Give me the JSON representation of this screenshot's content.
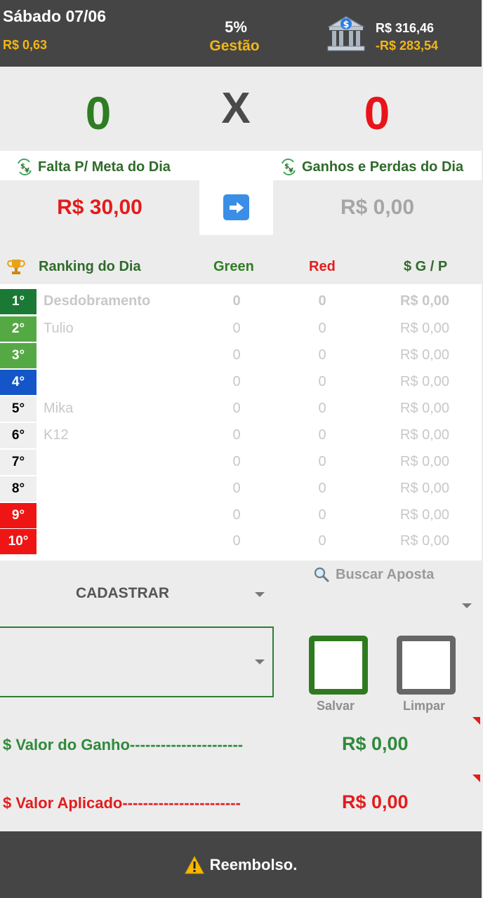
{
  "header": {
    "date": "Sábado 07/06",
    "left_value": "R$ 0,63",
    "percent": "5%",
    "gestao": "Gestão",
    "bank_icon": "bank-icon",
    "balance_primary": "R$ 316,46",
    "balance_secondary": "-R$ 283,54"
  },
  "score": {
    "green": "0",
    "separator": "X",
    "red": "0"
  },
  "meta": {
    "left_title": "Falta P/ Meta do Dia",
    "left_value": "R$ 30,00",
    "right_title": "Ganhos e Perdas do Dia",
    "right_value": "R$ 0,00",
    "arrow_icon": "arrow-right-icon"
  },
  "ranking": {
    "title": "Ranking do Dia",
    "col_green": "Green",
    "col_red": "Red",
    "col_gp": "$ G / P",
    "rows": [
      {
        "pos": "1°",
        "name": "Desdobramento",
        "green": "0",
        "red": "0",
        "gp": "R$ 0,00"
      },
      {
        "pos": "2°",
        "name": "Tulio",
        "green": "0",
        "red": "0",
        "gp": "R$ 0,00"
      },
      {
        "pos": "3°",
        "name": "",
        "green": "0",
        "red": "0",
        "gp": "R$ 0,00"
      },
      {
        "pos": "4°",
        "name": "",
        "green": "0",
        "red": "0",
        "gp": "R$ 0,00"
      },
      {
        "pos": "5°",
        "name": "Mika",
        "green": "0",
        "red": "0",
        "gp": "R$ 0,00"
      },
      {
        "pos": "6°",
        "name": "K12",
        "green": "0",
        "red": "0",
        "gp": "R$ 0,00"
      },
      {
        "pos": "7°",
        "name": "",
        "green": "0",
        "red": "0",
        "gp": "R$ 0,00"
      },
      {
        "pos": "8°",
        "name": "",
        "green": "0",
        "red": "0",
        "gp": "R$ 0,00"
      },
      {
        "pos": "9°",
        "name": "",
        "green": "0",
        "red": "0",
        "gp": "R$ 0,00"
      },
      {
        "pos": "10°",
        "name": "",
        "green": "0",
        "red": "0",
        "gp": "R$ 0,00"
      }
    ]
  },
  "form": {
    "cadastrar": "CADASTRAR",
    "search_label": "Buscar Aposta",
    "save_label": "Salvar",
    "clear_label": "Limpar",
    "gain_label": "$ Valor do Ganho----------------------",
    "gain_value": "R$ 0,00",
    "applied_label": "$ Valor Aplicado-----------------------",
    "applied_value": "R$ 0,00"
  },
  "footer": {
    "label": "Reembolso."
  },
  "colors": {
    "header_bg": "#454545",
    "accent_yellow": "#f2b617",
    "green": "#2f7d23",
    "red": "#e31c1c"
  }
}
